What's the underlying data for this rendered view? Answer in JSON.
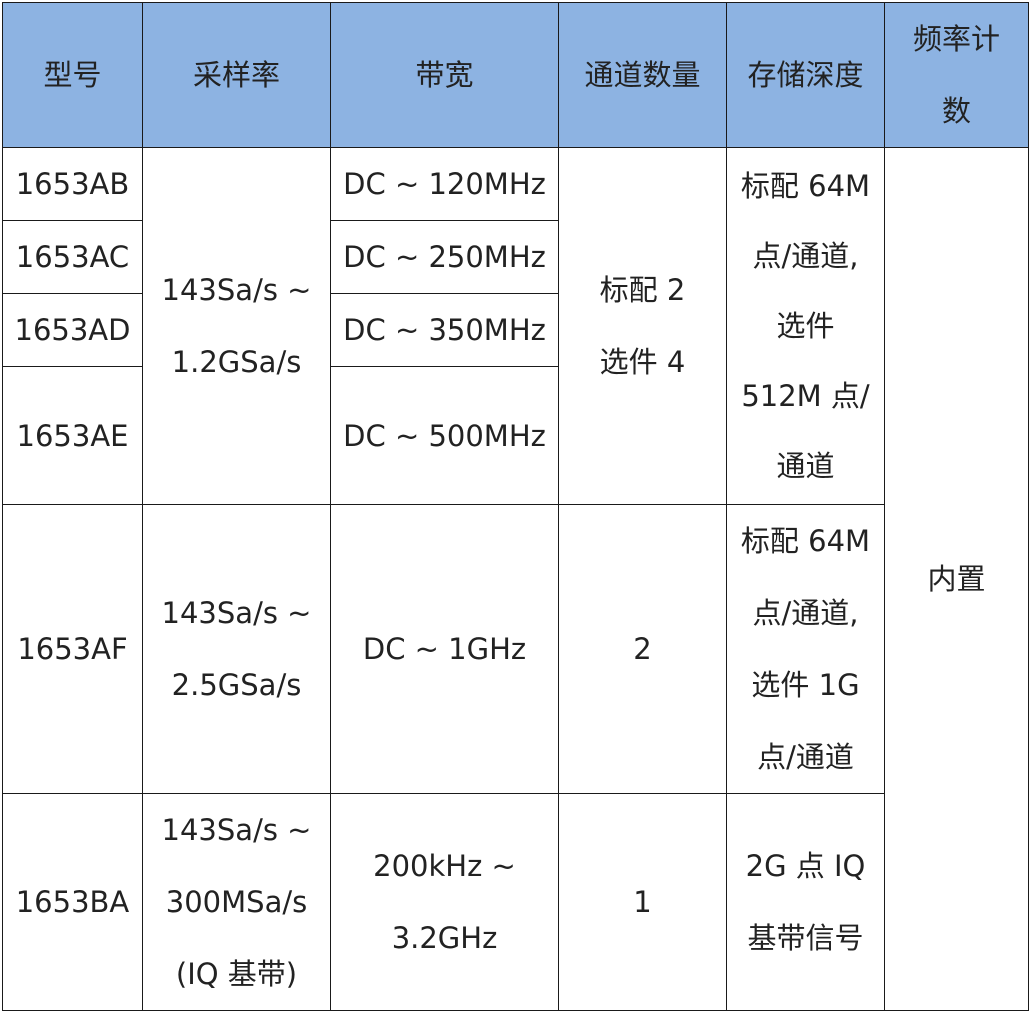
{
  "headers": [
    "型号",
    "采样率",
    "带宽",
    "通道数量",
    "存储深度",
    "频率计",
    "数"
  ],
  "group1": {
    "models": [
      "1653AB",
      "1653AC",
      "1653AD",
      "1653AE"
    ],
    "sample_rate": [
      "143Sa/s ~",
      "1.2GSa/s"
    ],
    "bandwidths": [
      "DC ~ 120MHz",
      "DC ~ 250MHz",
      "DC ~ 350MHz",
      "DC ~ 500MHz"
    ],
    "channels": [
      "标配 2",
      "选件 4"
    ],
    "memory": [
      "标配 64M",
      "点/通道,",
      "选件",
      "512M 点/",
      "通道"
    ]
  },
  "freq_counter": "内置",
  "group2": {
    "model": "1653AF",
    "sample_rate": [
      "143Sa/s ~",
      "2.5GSa/s"
    ],
    "bandwidth": "DC ~ 1GHz",
    "channels": "2",
    "memory": [
      "标配 64M",
      "点/通道,",
      "选件 1G",
      "点/通道"
    ]
  },
  "group3": {
    "model": "1653BA",
    "sample_rate": [
      "143Sa/s ~",
      "300MSa/s",
      "(IQ 基带)"
    ],
    "bandwidth": [
      "200kHz ~",
      "3.2GHz"
    ],
    "channels": "1",
    "memory": [
      "2G 点 IQ",
      "基带信号"
    ]
  }
}
